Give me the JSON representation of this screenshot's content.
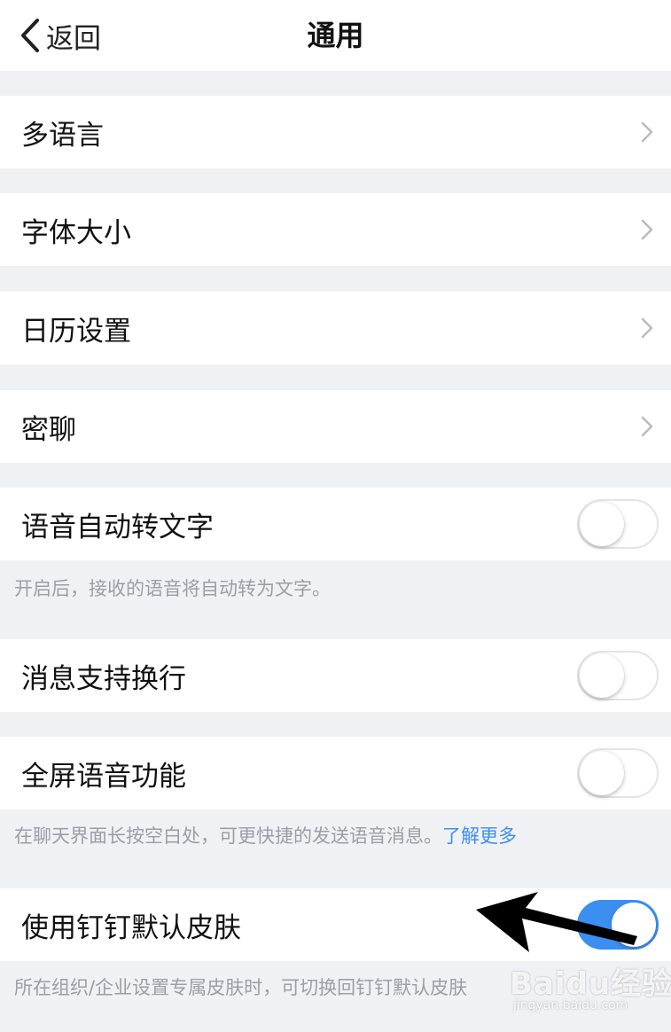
{
  "nav": {
    "back_label": "返回",
    "title": "通用"
  },
  "rows": {
    "language": "多语言",
    "font_size": "字体大小",
    "calendar": "日历设置",
    "secret_chat": "密聊",
    "voice_to_text": "语音自动转文字",
    "msg_newline": "消息支持换行",
    "fullscreen_voice": "全屏语音功能",
    "default_skin": "使用钉钉默认皮肤"
  },
  "toggles": {
    "voice_to_text": false,
    "msg_newline": false,
    "fullscreen_voice": false,
    "default_skin": true
  },
  "notes": {
    "voice_to_text": "开启后，接收的语音将自动转为文字。",
    "fullscreen_voice": "在聊天界面长按空白处，可更快捷的发送语音消息。",
    "fullscreen_voice_link": "了解更多",
    "default_skin": "所在组织/企业设置专属皮肤时，可切换回钉钉默认皮肤"
  },
  "watermark": {
    "logo": "Baidu经验",
    "sub": "jingyan.baidu.com"
  },
  "colors": {
    "accent": "#3b8ff0",
    "background": "#f0f1f5",
    "note_text": "#9b9ea6"
  },
  "icons": {
    "back": "chevron-left-icon",
    "disclosure": "chevron-right-icon",
    "annotation": "arrow-left-icon"
  }
}
